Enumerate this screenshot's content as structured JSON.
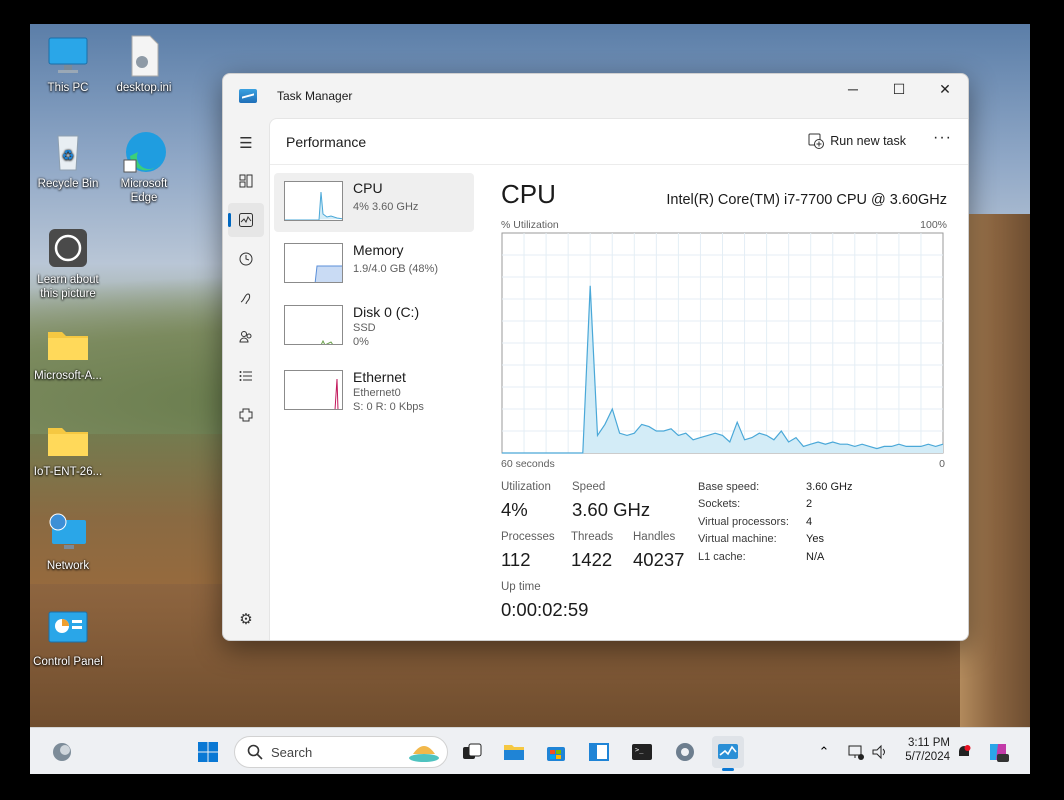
{
  "desktop": {
    "icons": [
      {
        "label": "This PC"
      },
      {
        "label": "desktop.ini"
      },
      {
        "label": "Recycle Bin"
      },
      {
        "label": "Microsoft Edge"
      },
      {
        "label": "Learn about this picture"
      },
      {
        "label": "Microsoft-A..."
      },
      {
        "label": "IoT-ENT-26..."
      },
      {
        "label": "Network"
      },
      {
        "label": "Control Panel"
      }
    ]
  },
  "window": {
    "title": "Task Manager",
    "page_title": "Performance",
    "run_new_task": "Run new task",
    "more": "···"
  },
  "devices": [
    {
      "name": "CPU",
      "line1": "4% 3.60 GHz",
      "line2": ""
    },
    {
      "name": "Memory",
      "line1": "1.9/4.0 GB (48%)",
      "line2": ""
    },
    {
      "name": "Disk 0 (C:)",
      "line1": "SSD",
      "line2": "0%"
    },
    {
      "name": "Ethernet",
      "line1": "Ethernet0",
      "line2": "S: 0 R: 0 Kbps"
    }
  ],
  "cpu": {
    "title": "CPU",
    "model": "Intel(R) Core(TM) i7-7700 CPU @ 3.60GHz",
    "y_label": "% Utilization",
    "y_max_label": "100%",
    "x_left_label": "60 seconds",
    "x_right_label": "0",
    "utilization_label": "Utilization",
    "utilization": "4%",
    "speed_label": "Speed",
    "speed": "3.60 GHz",
    "processes_label": "Processes",
    "processes": "112",
    "threads_label": "Threads",
    "threads": "1422",
    "handles_label": "Handles",
    "handles": "40237",
    "uptime_label": "Up time",
    "uptime": "0:00:02:59",
    "details": [
      {
        "key": "Base speed:",
        "value": "3.60 GHz"
      },
      {
        "key": "Sockets:",
        "value": "2"
      },
      {
        "key": "Virtual processors:",
        "value": "4"
      },
      {
        "key": "Virtual machine:",
        "value": "Yes"
      },
      {
        "key": "L1 cache:",
        "value": "N/A"
      }
    ]
  },
  "chart_data": {
    "type": "area",
    "x": [
      60,
      49,
      48,
      47,
      46,
      45,
      44,
      43,
      42,
      41,
      40,
      39,
      38,
      37,
      36,
      35,
      34,
      33,
      32,
      31,
      30,
      29,
      28,
      27,
      26,
      25,
      24,
      23,
      22,
      21,
      20,
      19,
      18,
      17,
      16,
      15,
      14,
      13,
      12,
      11,
      10,
      9,
      8,
      7,
      6,
      5,
      4,
      3,
      2,
      1,
      0
    ],
    "values": [
      0,
      0,
      76,
      8,
      13,
      20,
      9,
      8,
      9,
      13,
      12,
      10,
      10,
      11,
      8,
      9,
      6,
      7,
      8,
      9,
      8,
      5,
      14,
      6,
      7,
      9,
      8,
      6,
      10,
      5,
      7,
      3,
      4,
      5,
      4,
      5,
      4,
      4,
      3,
      4,
      3,
      2,
      3,
      3,
      4,
      3,
      3,
      3,
      4,
      3,
      4
    ],
    "ylim": [
      0,
      100
    ],
    "color": "#4aa8d8",
    "fill": "#d3ecf7"
  },
  "taskbar": {
    "search_placeholder": "Search",
    "time": "3:11 PM",
    "date": "5/7/2024"
  }
}
